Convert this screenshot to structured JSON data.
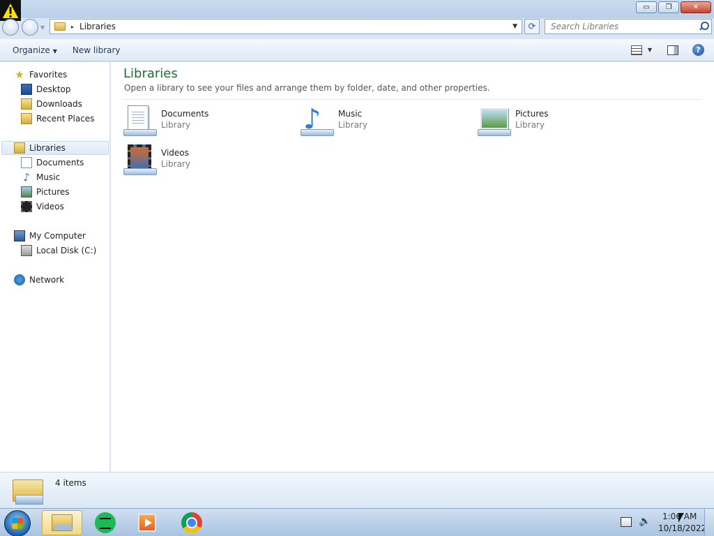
{
  "window": {
    "title_warning_icon": "warning-icon",
    "caption": {
      "minimize": "▭",
      "restore": "❐",
      "close": "✕"
    }
  },
  "address": {
    "path": "Libraries",
    "separator": "▸",
    "search_placeholder": "Search Libraries"
  },
  "toolbar": {
    "organize_label": "Organize",
    "new_library_label": "New library"
  },
  "navpane": {
    "favorites": {
      "label": "Favorites",
      "icon": "star-icon"
    },
    "favorites_items": [
      {
        "label": "Desktop",
        "icon": "desktop-icon"
      },
      {
        "label": "Downloads",
        "icon": "downloads-icon"
      },
      {
        "label": "Recent Places",
        "icon": "recent-places-icon"
      }
    ],
    "libraries": {
      "label": "Libraries",
      "icon": "libraries-icon",
      "selected": true
    },
    "libraries_items": [
      {
        "label": "Documents",
        "icon": "documents-icon"
      },
      {
        "label": "Music",
        "icon": "music-icon"
      },
      {
        "label": "Pictures",
        "icon": "pictures-icon"
      },
      {
        "label": "Videos",
        "icon": "videos-icon"
      }
    ],
    "computer": {
      "label": "My Computer",
      "icon": "computer-icon"
    },
    "computer_items": [
      {
        "label": "Local Disk (C:)",
        "icon": "disk-icon"
      }
    ],
    "network": {
      "label": "Network",
      "icon": "network-icon"
    }
  },
  "content": {
    "title": "Libraries",
    "subtitle": "Open a library to see your files and arrange them by folder, date, and other properties.",
    "libraries": [
      {
        "name": "Documents",
        "type": "Library",
        "icon": "documents-library-icon"
      },
      {
        "name": "Music",
        "type": "Library",
        "icon": "music-library-icon"
      },
      {
        "name": "Pictures",
        "type": "Library",
        "icon": "pictures-library-icon"
      },
      {
        "name": "Videos",
        "type": "Library",
        "icon": "videos-library-icon"
      }
    ]
  },
  "statusbar": {
    "item_count": "4 items"
  },
  "taskbar": {
    "apps": [
      "windows-explorer",
      "spotify",
      "media-player",
      "chrome"
    ],
    "clock_time": "1:06 AM",
    "clock_date": "10/18/2022"
  },
  "colors": {
    "title_green": "#1e6e2e",
    "accent_blue": "#2d5c94"
  }
}
